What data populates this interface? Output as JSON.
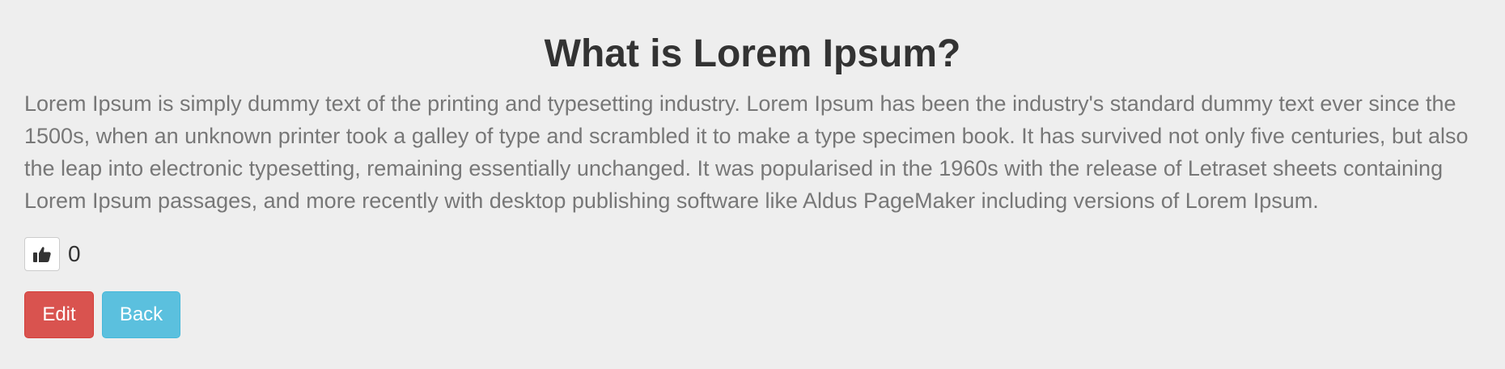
{
  "article": {
    "title": "What is Lorem Ipsum?",
    "body": "Lorem Ipsum is simply dummy text of the printing and typesetting industry. Lorem Ipsum has been the industry's standard dummy text ever since the 1500s, when an unknown printer took a galley of type and scrambled it to make a type specimen book. It has survived not only five centuries, but also the leap into electronic typesetting, remaining essentially unchanged. It was popularised in the 1960s with the release of Letraset sheets containing Lorem Ipsum passages, and more recently with desktop publishing software like Aldus PageMaker including versions of Lorem Ipsum."
  },
  "like": {
    "icon": "thumbs-up-icon",
    "count": "0"
  },
  "actions": {
    "edit_label": "Edit",
    "back_label": "Back"
  },
  "colors": {
    "background": "#eeeeee",
    "title": "#333333",
    "body_text": "#777777",
    "edit_button": "#d9534f",
    "back_button": "#5bc0de"
  }
}
